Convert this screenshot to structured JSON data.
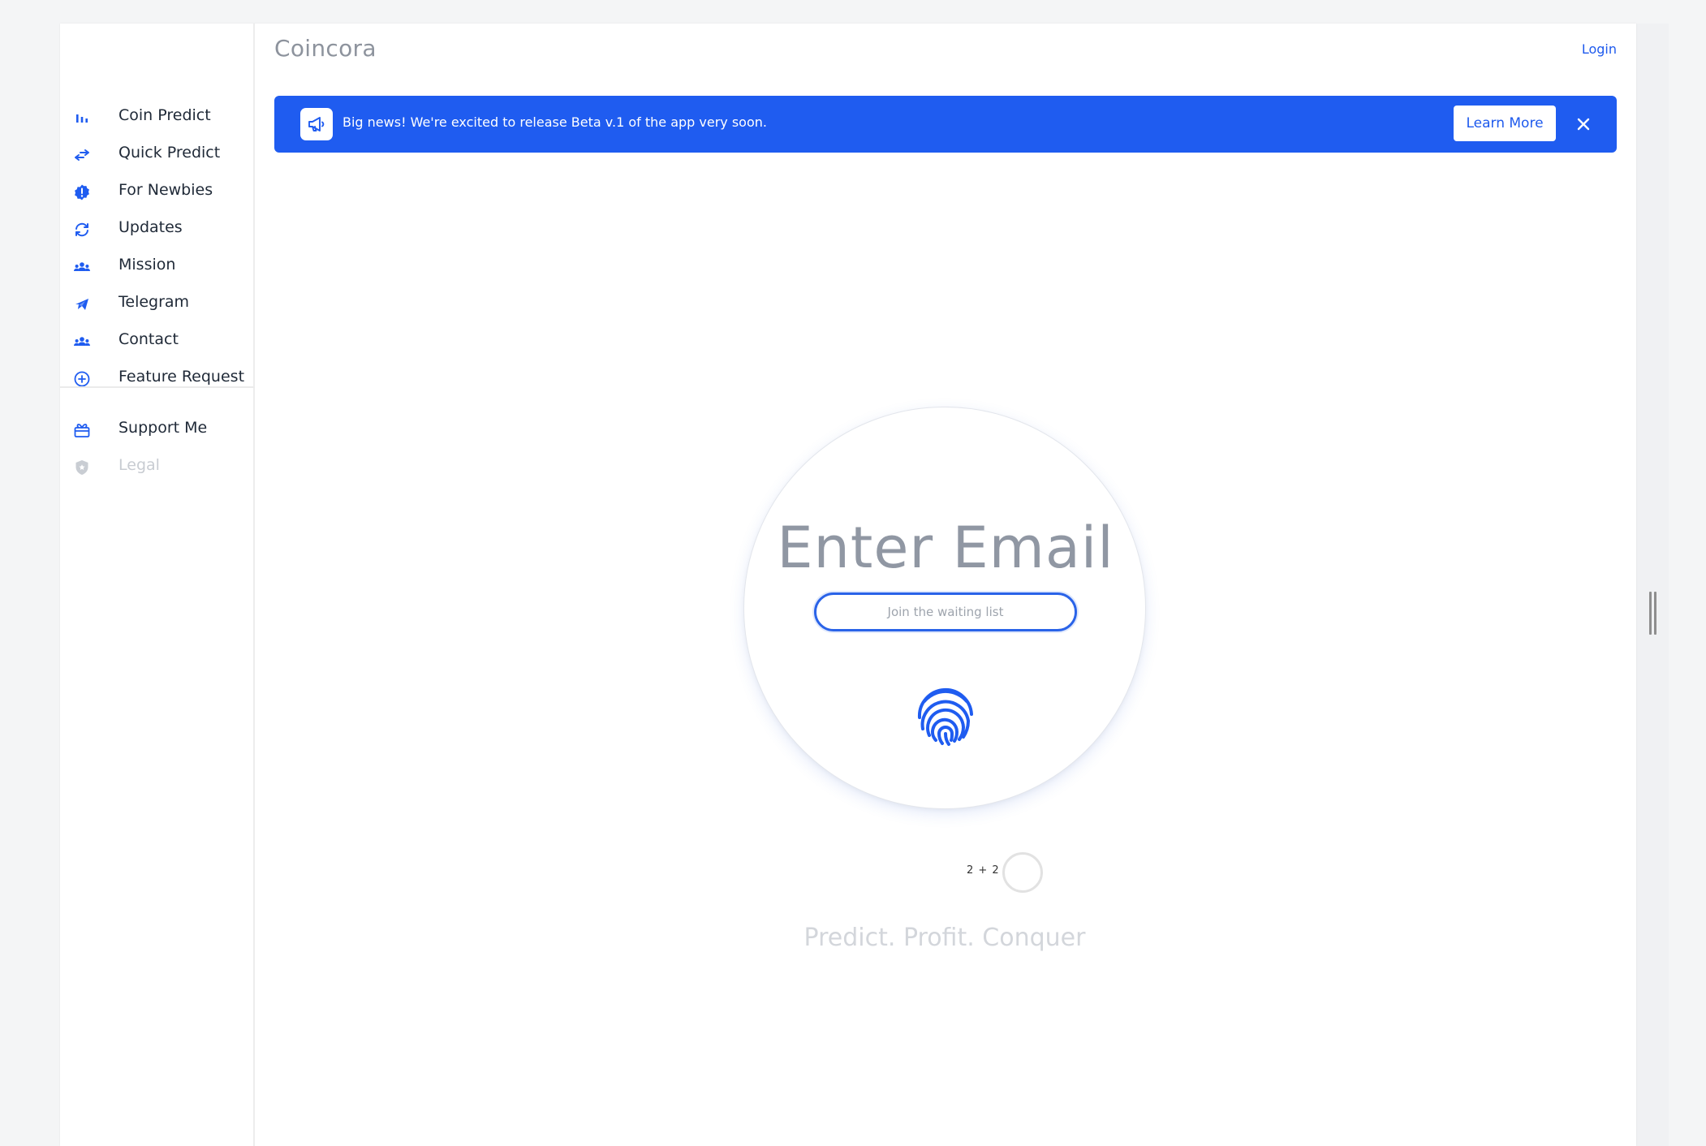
{
  "app": {
    "brand": "Coincora",
    "login_label": "Login"
  },
  "sidebar": {
    "items": [
      {
        "label": "Coin Predict",
        "icon": "bar-chart-icon"
      },
      {
        "label": "Quick Predict",
        "icon": "swap-arrows-icon"
      },
      {
        "label": "For Newbies",
        "icon": "alert-badge-icon"
      },
      {
        "label": "Updates",
        "icon": "refresh-icon"
      },
      {
        "label": "Mission",
        "icon": "users-group-icon"
      },
      {
        "label": "Telegram",
        "icon": "paper-plane-icon"
      },
      {
        "label": "Contact",
        "icon": "users-group-icon"
      },
      {
        "label": "Feature Request",
        "icon": "plus-circle-icon"
      }
    ],
    "secondary": [
      {
        "label": "Support Me",
        "icon": "gift-icon"
      },
      {
        "label": "Legal",
        "icon": "shield-star-icon",
        "disabled": true
      }
    ]
  },
  "banner": {
    "text": "Big news! We're excited to release Beta v.1 of the app very soon.",
    "button_label": "Learn More",
    "icon": "megaphone-icon"
  },
  "signup": {
    "title": "Enter Email",
    "placeholder": "Join the waiting list",
    "fingerprint_icon": "fingerprint-icon"
  },
  "captcha": {
    "question": "2 + 2"
  },
  "tagline": "Predict. Profit. Conquer",
  "colors": {
    "accent": "#1f5cf0",
    "text": "#1f2937",
    "muted": "#9097a3"
  }
}
